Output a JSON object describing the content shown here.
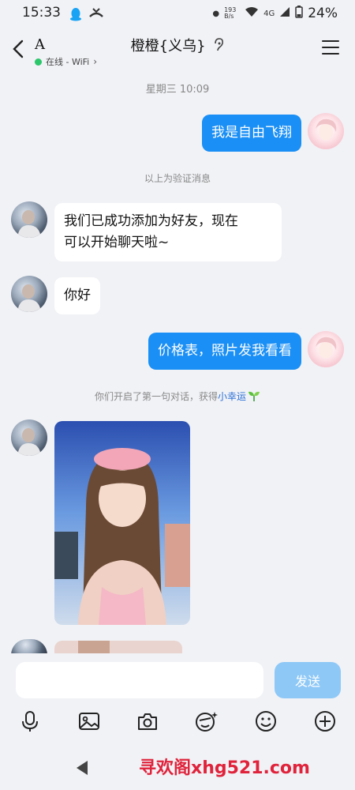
{
  "status_bar": {
    "time": "15:33",
    "net_speed": "193 B/s",
    "network": "4G",
    "battery": "24%"
  },
  "header": {
    "contact_initial": "A",
    "online_status": "在线 - WiFi",
    "chat_title": "橙橙{义乌}"
  },
  "messages": {
    "timestamp": "星期三 10:09",
    "out_1": "我是自由飞翔",
    "verify_note": "以上为验证消息",
    "in_1_line1": "我们已成功添加为好友，现在",
    "in_1_line2": "可以开始聊天啦~",
    "in_2": "你好",
    "out_2": "价格表，照片发我看看",
    "first_chat_note": "你们开启了第一句对话，获得",
    "lucky_link": "小幸运"
  },
  "input": {
    "placeholder": "",
    "send_label": "发送"
  },
  "watermark": "寻欢阁xhg521.com",
  "colors": {
    "accent": "#1a8ff5",
    "send_disabled": "#8ec8f7",
    "online": "#2cc66b",
    "watermark": "#e0233b",
    "background": "#f1f2f6"
  },
  "icons": [
    "back-icon",
    "ear-icon",
    "menu-icon",
    "microphone-icon",
    "image-icon",
    "camera-icon",
    "sticker-icon",
    "emoji-icon",
    "plus-icon",
    "sprout-icon",
    "nav-back-icon"
  ]
}
